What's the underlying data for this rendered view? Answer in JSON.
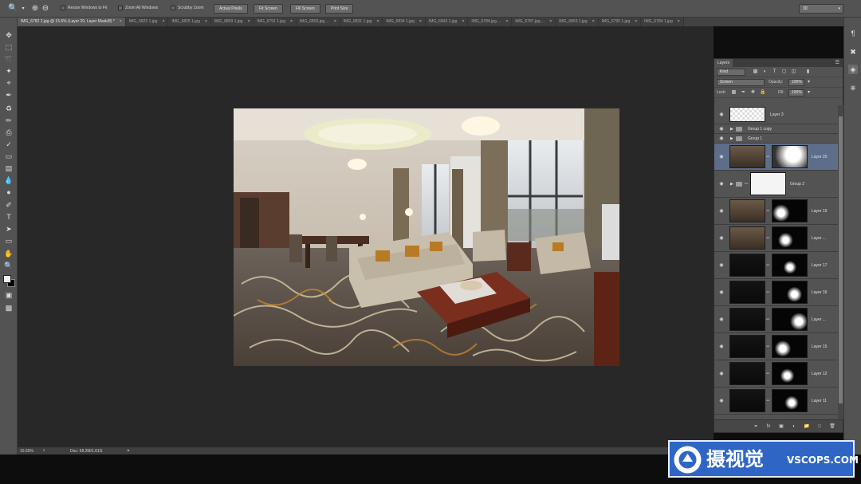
{
  "options_bar": {
    "tool_icon": "zoom-icon",
    "checkboxes": [
      "Resize Windows to Fit",
      "Zoom All Windows",
      "Scrubby Zoom"
    ],
    "buttons": [
      "Actual Pixels",
      "Fit Screen",
      "Fill Screen",
      "Print Size"
    ],
    "workspace": "3D"
  },
  "tabs": [
    {
      "label": "IMG_6782 2.jpg @ 15.6% (Layer 20, Layer Mask/8) *",
      "active": true
    },
    {
      "label": "IMG_6823 1.jpg"
    },
    {
      "label": "IMG_6825 1.jpg"
    },
    {
      "label": "IMG_6809 1.jpg"
    },
    {
      "label": "IMG_6791 1.jpg"
    },
    {
      "label": "IMG_6803.jpg ..."
    },
    {
      "label": "IMG_6831 1.jpg"
    },
    {
      "label": "IMG_6834 1.jpg"
    },
    {
      "label": "IMG_6843 1.jpg"
    },
    {
      "label": "IMG_6784.jpg ..."
    },
    {
      "label": "IMG_6787.jpg ..."
    },
    {
      "label": "IMG_6853 1.jpg"
    },
    {
      "label": "IMG_6795 1.jpg"
    },
    {
      "label": "IMG_6784 1.jpg"
    }
  ],
  "tab_close_glyph": "×",
  "status": {
    "zoom": "15.55%",
    "doc": "Doc: 58.2M/1.61G"
  },
  "layers_panel": {
    "title": "Layers",
    "filter_kind": "Kind",
    "blend_mode": "Screen",
    "opacity_label": "Opacity:",
    "opacity_value": "100%",
    "lock_label": "Lock:",
    "fill_label": "Fill:",
    "fill_value": "100%",
    "layers": [
      {
        "name": "Layer 3",
        "kind": "transparent"
      },
      {
        "name": "Group 1 copy",
        "kind": "group"
      },
      {
        "name": "Group 1",
        "kind": "group"
      },
      {
        "name": "Layer 20",
        "kind": "masked",
        "selected": true
      },
      {
        "name": "Group 2",
        "kind": "group-mask"
      },
      {
        "name": "Layer 19",
        "kind": "masked"
      },
      {
        "name": "Layer ...",
        "kind": "masked"
      },
      {
        "name": "Layer 17",
        "kind": "masked"
      },
      {
        "name": "Layer 16",
        "kind": "masked"
      },
      {
        "name": "Layer ...",
        "kind": "masked"
      },
      {
        "name": "Layer 15",
        "kind": "masked"
      },
      {
        "name": "Layer 12",
        "kind": "masked"
      },
      {
        "name": "Layer 11",
        "kind": "masked"
      }
    ]
  },
  "watermark": {
    "brand": "摄视觉",
    "domain": "VSCOPS.COM"
  },
  "colors": {
    "panel": "#535353",
    "canvas_bg": "#282828",
    "selected_layer": "#5d6e8a",
    "watermark_blue": "#2f66c6"
  }
}
